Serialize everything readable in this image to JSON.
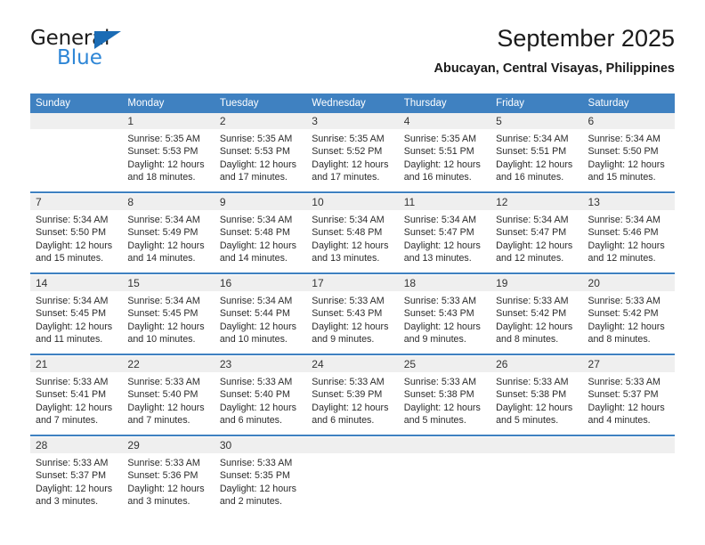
{
  "brand": {
    "line1": "General",
    "line2": "Blue",
    "accent_color": "#2e86d6",
    "triangle_color": "#1b6cb5"
  },
  "header": {
    "title": "September 2025",
    "subtitle": "Abucayan, Central Visayas, Philippines"
  },
  "theme": {
    "header_bg": "#3f81c1",
    "daynum_bg": "#efefef",
    "separator": "#3f81c1"
  },
  "weekday_headers": [
    "Sunday",
    "Monday",
    "Tuesday",
    "Wednesday",
    "Thursday",
    "Friday",
    "Saturday"
  ],
  "weeks": [
    {
      "days": [
        {
          "num": "",
          "empty": true,
          "sunrise": "",
          "sunset": "",
          "daylight1": "",
          "daylight2": ""
        },
        {
          "num": "1",
          "empty": false,
          "sunrise": "Sunrise: 5:35 AM",
          "sunset": "Sunset: 5:53 PM",
          "daylight1": "Daylight: 12 hours",
          "daylight2": "and 18 minutes."
        },
        {
          "num": "2",
          "empty": false,
          "sunrise": "Sunrise: 5:35 AM",
          "sunset": "Sunset: 5:53 PM",
          "daylight1": "Daylight: 12 hours",
          "daylight2": "and 17 minutes."
        },
        {
          "num": "3",
          "empty": false,
          "sunrise": "Sunrise: 5:35 AM",
          "sunset": "Sunset: 5:52 PM",
          "daylight1": "Daylight: 12 hours",
          "daylight2": "and 17 minutes."
        },
        {
          "num": "4",
          "empty": false,
          "sunrise": "Sunrise: 5:35 AM",
          "sunset": "Sunset: 5:51 PM",
          "daylight1": "Daylight: 12 hours",
          "daylight2": "and 16 minutes."
        },
        {
          "num": "5",
          "empty": false,
          "sunrise": "Sunrise: 5:34 AM",
          "sunset": "Sunset: 5:51 PM",
          "daylight1": "Daylight: 12 hours",
          "daylight2": "and 16 minutes."
        },
        {
          "num": "6",
          "empty": false,
          "sunrise": "Sunrise: 5:34 AM",
          "sunset": "Sunset: 5:50 PM",
          "daylight1": "Daylight: 12 hours",
          "daylight2": "and 15 minutes."
        }
      ]
    },
    {
      "days": [
        {
          "num": "7",
          "empty": false,
          "sunrise": "Sunrise: 5:34 AM",
          "sunset": "Sunset: 5:50 PM",
          "daylight1": "Daylight: 12 hours",
          "daylight2": "and 15 minutes."
        },
        {
          "num": "8",
          "empty": false,
          "sunrise": "Sunrise: 5:34 AM",
          "sunset": "Sunset: 5:49 PM",
          "daylight1": "Daylight: 12 hours",
          "daylight2": "and 14 minutes."
        },
        {
          "num": "9",
          "empty": false,
          "sunrise": "Sunrise: 5:34 AM",
          "sunset": "Sunset: 5:48 PM",
          "daylight1": "Daylight: 12 hours",
          "daylight2": "and 14 minutes."
        },
        {
          "num": "10",
          "empty": false,
          "sunrise": "Sunrise: 5:34 AM",
          "sunset": "Sunset: 5:48 PM",
          "daylight1": "Daylight: 12 hours",
          "daylight2": "and 13 minutes."
        },
        {
          "num": "11",
          "empty": false,
          "sunrise": "Sunrise: 5:34 AM",
          "sunset": "Sunset: 5:47 PM",
          "daylight1": "Daylight: 12 hours",
          "daylight2": "and 13 minutes."
        },
        {
          "num": "12",
          "empty": false,
          "sunrise": "Sunrise: 5:34 AM",
          "sunset": "Sunset: 5:47 PM",
          "daylight1": "Daylight: 12 hours",
          "daylight2": "and 12 minutes."
        },
        {
          "num": "13",
          "empty": false,
          "sunrise": "Sunrise: 5:34 AM",
          "sunset": "Sunset: 5:46 PM",
          "daylight1": "Daylight: 12 hours",
          "daylight2": "and 12 minutes."
        }
      ]
    },
    {
      "days": [
        {
          "num": "14",
          "empty": false,
          "sunrise": "Sunrise: 5:34 AM",
          "sunset": "Sunset: 5:45 PM",
          "daylight1": "Daylight: 12 hours",
          "daylight2": "and 11 minutes."
        },
        {
          "num": "15",
          "empty": false,
          "sunrise": "Sunrise: 5:34 AM",
          "sunset": "Sunset: 5:45 PM",
          "daylight1": "Daylight: 12 hours",
          "daylight2": "and 10 minutes."
        },
        {
          "num": "16",
          "empty": false,
          "sunrise": "Sunrise: 5:34 AM",
          "sunset": "Sunset: 5:44 PM",
          "daylight1": "Daylight: 12 hours",
          "daylight2": "and 10 minutes."
        },
        {
          "num": "17",
          "empty": false,
          "sunrise": "Sunrise: 5:33 AM",
          "sunset": "Sunset: 5:43 PM",
          "daylight1": "Daylight: 12 hours",
          "daylight2": "and 9 minutes."
        },
        {
          "num": "18",
          "empty": false,
          "sunrise": "Sunrise: 5:33 AM",
          "sunset": "Sunset: 5:43 PM",
          "daylight1": "Daylight: 12 hours",
          "daylight2": "and 9 minutes."
        },
        {
          "num": "19",
          "empty": false,
          "sunrise": "Sunrise: 5:33 AM",
          "sunset": "Sunset: 5:42 PM",
          "daylight1": "Daylight: 12 hours",
          "daylight2": "and 8 minutes."
        },
        {
          "num": "20",
          "empty": false,
          "sunrise": "Sunrise: 5:33 AM",
          "sunset": "Sunset: 5:42 PM",
          "daylight1": "Daylight: 12 hours",
          "daylight2": "and 8 minutes."
        }
      ]
    },
    {
      "days": [
        {
          "num": "21",
          "empty": false,
          "sunrise": "Sunrise: 5:33 AM",
          "sunset": "Sunset: 5:41 PM",
          "daylight1": "Daylight: 12 hours",
          "daylight2": "and 7 minutes."
        },
        {
          "num": "22",
          "empty": false,
          "sunrise": "Sunrise: 5:33 AM",
          "sunset": "Sunset: 5:40 PM",
          "daylight1": "Daylight: 12 hours",
          "daylight2": "and 7 minutes."
        },
        {
          "num": "23",
          "empty": false,
          "sunrise": "Sunrise: 5:33 AM",
          "sunset": "Sunset: 5:40 PM",
          "daylight1": "Daylight: 12 hours",
          "daylight2": "and 6 minutes."
        },
        {
          "num": "24",
          "empty": false,
          "sunrise": "Sunrise: 5:33 AM",
          "sunset": "Sunset: 5:39 PM",
          "daylight1": "Daylight: 12 hours",
          "daylight2": "and 6 minutes."
        },
        {
          "num": "25",
          "empty": false,
          "sunrise": "Sunrise: 5:33 AM",
          "sunset": "Sunset: 5:38 PM",
          "daylight1": "Daylight: 12 hours",
          "daylight2": "and 5 minutes."
        },
        {
          "num": "26",
          "empty": false,
          "sunrise": "Sunrise: 5:33 AM",
          "sunset": "Sunset: 5:38 PM",
          "daylight1": "Daylight: 12 hours",
          "daylight2": "and 5 minutes."
        },
        {
          "num": "27",
          "empty": false,
          "sunrise": "Sunrise: 5:33 AM",
          "sunset": "Sunset: 5:37 PM",
          "daylight1": "Daylight: 12 hours",
          "daylight2": "and 4 minutes."
        }
      ]
    },
    {
      "days": [
        {
          "num": "28",
          "empty": false,
          "sunrise": "Sunrise: 5:33 AM",
          "sunset": "Sunset: 5:37 PM",
          "daylight1": "Daylight: 12 hours",
          "daylight2": "and 3 minutes."
        },
        {
          "num": "29",
          "empty": false,
          "sunrise": "Sunrise: 5:33 AM",
          "sunset": "Sunset: 5:36 PM",
          "daylight1": "Daylight: 12 hours",
          "daylight2": "and 3 minutes."
        },
        {
          "num": "30",
          "empty": false,
          "sunrise": "Sunrise: 5:33 AM",
          "sunset": "Sunset: 5:35 PM",
          "daylight1": "Daylight: 12 hours",
          "daylight2": "and 2 minutes."
        },
        {
          "num": "",
          "empty": true,
          "sunrise": "",
          "sunset": "",
          "daylight1": "",
          "daylight2": ""
        },
        {
          "num": "",
          "empty": true,
          "sunrise": "",
          "sunset": "",
          "daylight1": "",
          "daylight2": ""
        },
        {
          "num": "",
          "empty": true,
          "sunrise": "",
          "sunset": "",
          "daylight1": "",
          "daylight2": ""
        },
        {
          "num": "",
          "empty": true,
          "sunrise": "",
          "sunset": "",
          "daylight1": "",
          "daylight2": ""
        }
      ]
    }
  ]
}
